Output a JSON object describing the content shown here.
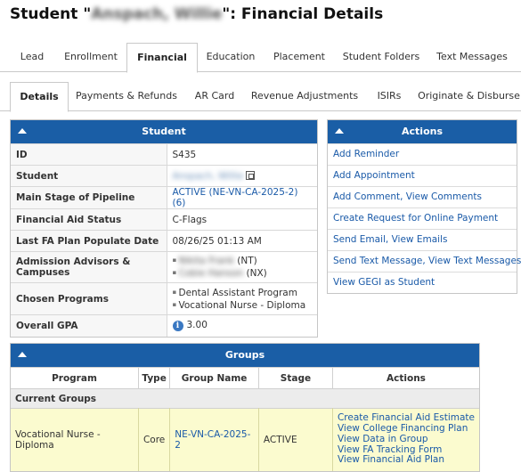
{
  "title": {
    "prefix": "Student \"",
    "student_name": "Anspach, Willie",
    "suffix": "\": Financial Details"
  },
  "main_tabs": [
    {
      "label": "Lead"
    },
    {
      "label": "Enrollment"
    },
    {
      "label": "Financial"
    },
    {
      "label": "Education"
    },
    {
      "label": "Placement"
    },
    {
      "label": "Student Folders"
    },
    {
      "label": "Text Messages"
    }
  ],
  "sub_tabs": [
    {
      "label": "Details"
    },
    {
      "label": "Payments & Refunds"
    },
    {
      "label": "AR Card"
    },
    {
      "label": "Revenue Adjustments"
    },
    {
      "label": "ISIRs"
    },
    {
      "label": "Originate & Disburse"
    }
  ],
  "student_panel": {
    "header": "Student",
    "rows": {
      "id": {
        "label": "ID",
        "value": "S435"
      },
      "student": {
        "label": "Student",
        "value": "Anspach, Willie"
      },
      "stage": {
        "label": "Main Stage of Pipeline",
        "value": "ACTIVE (NE-VN-CA-2025-2) (6)"
      },
      "fa_status": {
        "label": "Financial Aid Status",
        "value": "C-Flags"
      },
      "fa_plan": {
        "label": "Last FA Plan Populate Date",
        "value": "08/26/25 01:13 AM"
      },
      "advisors": {
        "label": "Admission Advisors & Campuses",
        "items": [
          {
            "name": "Nikita Frank",
            "campus": "(NT)"
          },
          {
            "name": "Cobie Hanson",
            "campus": "(NX)"
          }
        ]
      },
      "programs": {
        "label": "Chosen Programs",
        "items": [
          "Dental Assistant Program",
          "Vocational Nurse - Diploma"
        ]
      },
      "gpa": {
        "label": "Overall GPA",
        "value": "3.00"
      }
    }
  },
  "actions_panel": {
    "header": "Actions",
    "items": [
      "Add Reminder",
      "Add Appointment",
      "Add Comment, View Comments",
      "Create Request for Online Payment",
      "Send Email, View Emails",
      "Send Text Message, View Text Messages",
      "View GEGI as Student"
    ]
  },
  "groups_panel": {
    "header": "Groups",
    "columns": [
      "Program",
      "Type",
      "Group Name",
      "Stage",
      "Actions"
    ],
    "section_label": "Current Groups",
    "rows": [
      {
        "program": "Vocational Nurse - Diploma",
        "type": "Core",
        "group_name": "NE-VN-CA-2025-2",
        "stage": "ACTIVE",
        "actions": [
          "Create Financial Aid Estimate",
          "View College Financing Plan",
          "View Data in Group",
          "View FA Tracking Form",
          "View Financial Aid Plan"
        ]
      }
    ]
  },
  "colors": {
    "header_blue": "#1a5ea6",
    "link_blue": "#1a5aa8",
    "highlight_row": "#fbfbcf"
  },
  "icons": {
    "collapse": "caret-up-icon",
    "student_home": "home-icon",
    "gpa_info": "info-icon"
  }
}
